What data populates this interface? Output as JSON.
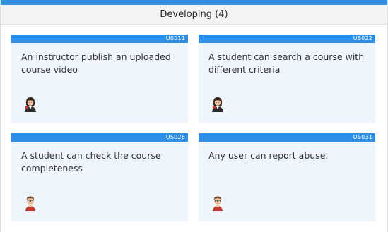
{
  "column": {
    "title": "Developing (4)"
  },
  "cards": [
    {
      "id": "US011",
      "text": "An instructor publish an uploaded course video",
      "avatar_icon": "female-avatar-icon"
    },
    {
      "id": "US022",
      "text": "A student can search a course with different criteria",
      "avatar_icon": "female-avatar-icon"
    },
    {
      "id": "US026",
      "text": "A student can check the course completeness",
      "avatar_icon": "male-avatar-icon"
    },
    {
      "id": "US031",
      "text": "Any user can report abuse.",
      "avatar_icon": "male-avatar-icon"
    }
  ],
  "colors": {
    "accent": "#2f8ee5",
    "card_background": "#eef5fd",
    "header_background": "#f3f3f3"
  }
}
